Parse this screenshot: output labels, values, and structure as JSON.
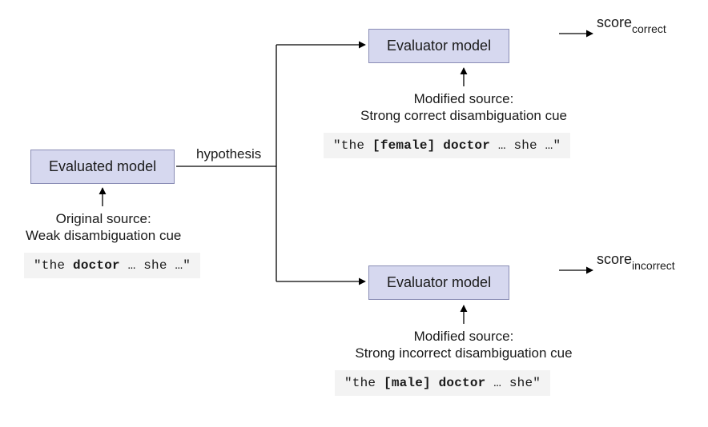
{
  "evaluated_model": {
    "label": "Evaluated model"
  },
  "evaluator_top": {
    "label": "Evaluator model"
  },
  "evaluator_bottom": {
    "label": "Evaluator model"
  },
  "original_source": {
    "caption_line1": "Original source:",
    "caption_line2": "Weak disambiguation cue",
    "example_prefix": "\"the ",
    "example_bold1": "doctor",
    "example_mid": " … she …\"",
    "example_bold2": ""
  },
  "mod_correct": {
    "caption_line1": "Modified source:",
    "caption_line2": "Strong correct disambiguation cue",
    "example_prefix": "\"the ",
    "example_bold1": "[female] doctor",
    "example_mid": " … she …\"",
    "example_bold2": ""
  },
  "mod_incorrect": {
    "caption_line1": "Modified source:",
    "caption_line2": "Strong incorrect disambiguation cue",
    "example_prefix": "\"the ",
    "example_bold1": "[male] doctor",
    "example_mid": " … she\"",
    "example_bold2": ""
  },
  "edge_hypothesis": "hypothesis",
  "score_correct": {
    "base": "score",
    "sub": "correct"
  },
  "score_incorrect": {
    "base": "score",
    "sub": "incorrect"
  }
}
